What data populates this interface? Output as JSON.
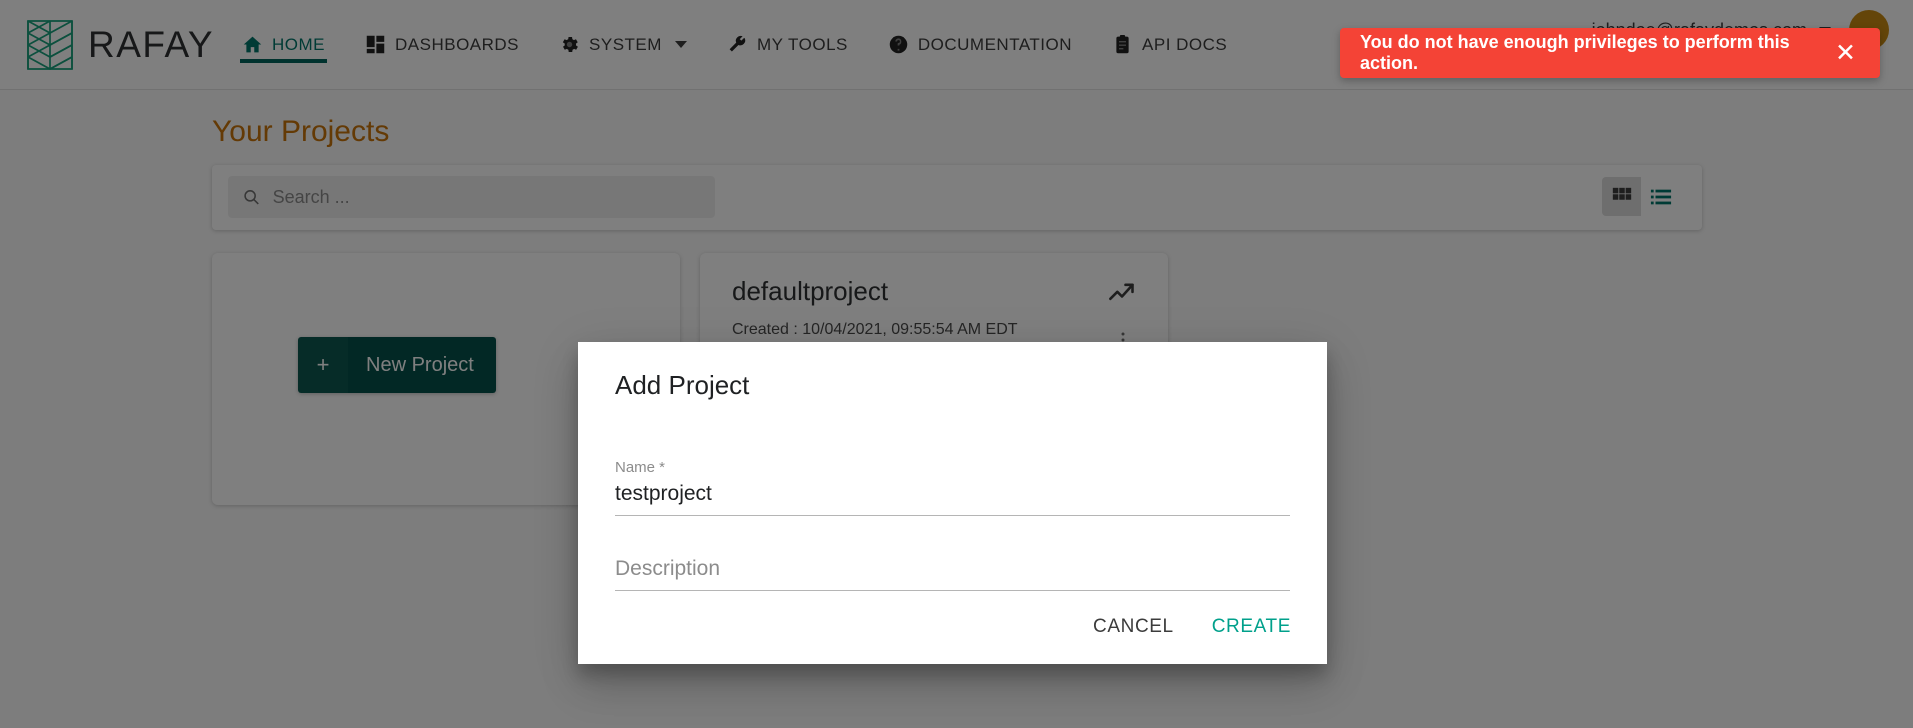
{
  "brand": {
    "name": "RAFAY",
    "logo_icon": "rafay-lattice-logo",
    "logo_color": "#19a07c",
    "wordmark_color": "#2f3133"
  },
  "topnav": {
    "items": [
      {
        "label": "HOME",
        "icon": "home-icon",
        "active": true
      },
      {
        "label": "DASHBOARDS",
        "icon": "dashboard-grid-icon",
        "active": false
      },
      {
        "label": "SYSTEM",
        "icon": "gear-icon",
        "active": false,
        "has_caret": true
      },
      {
        "label": "MY TOOLS",
        "icon": "wrench-icon",
        "active": false
      },
      {
        "label": "DOCUMENTATION",
        "icon": "help-circle-icon",
        "active": false
      },
      {
        "label": "API DOCS",
        "icon": "clipboard-icon",
        "active": false
      }
    ],
    "active_color": "#00766a",
    "account": {
      "email": "johndoe@rafaydemos.com",
      "caret_icon": "chevron-down-icon",
      "avatar_icon": "user-avatar",
      "avatar_color": "#c98a12"
    }
  },
  "page": {
    "title": "Your Projects",
    "title_color": "#c9740b"
  },
  "search": {
    "icon": "search-icon",
    "placeholder": "Search ...",
    "value": ""
  },
  "view_toggle": {
    "grid": {
      "icon": "grid-view-icon",
      "label": "Grid view",
      "selected": true
    },
    "list": {
      "icon": "list-view-icon",
      "label": "List view",
      "selected": false
    },
    "icon_color": "#00766a"
  },
  "new_project": {
    "plus": "+",
    "label": "New Project",
    "bg_color": "#05514a"
  },
  "projects": [
    {
      "name": "defaultproject",
      "created_label": "Created : 10/04/2021, 09:55:54 AM EDT",
      "trend_icon": "trending-up-icon"
    }
  ],
  "dialog": {
    "title": "Add Project",
    "fields": [
      {
        "label": "Name *",
        "value": "testproject",
        "placeholder": ""
      },
      {
        "label": "",
        "value": "",
        "placeholder": "Description"
      }
    ],
    "cancel_label": "CANCEL",
    "create_label": "CREATE",
    "create_color": "#00a08b"
  },
  "toast": {
    "message": "You do not have enough privileges to perform this action.",
    "close_icon": "close-icon",
    "bg_color": "#f44336"
  }
}
